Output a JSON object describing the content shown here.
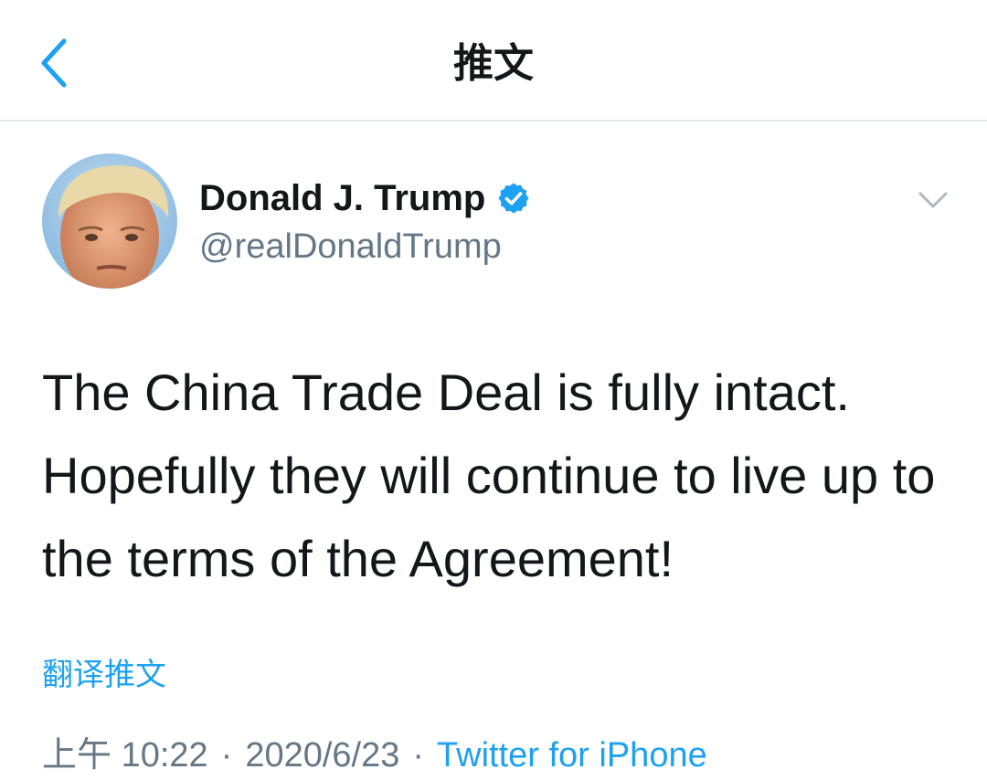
{
  "nav": {
    "title": "推文",
    "back_icon": "chevron-left-icon"
  },
  "colors": {
    "accent": "#1da1f2",
    "secondary_text": "#657786",
    "primary_text": "#14171a",
    "divider": "#e6ecf0"
  },
  "tweet": {
    "author_name": "Donald J. Trump",
    "author_handle": "@realDonaldTrump",
    "verified": true,
    "text": "The China Trade Deal is fully intact. Hopefully they will continue to live up to the terms of the Agreement!",
    "translate_label": "翻译推文",
    "time": "上午 10:22",
    "date": "2020/6/23",
    "separator": "·",
    "source": "Twitter for iPhone"
  }
}
